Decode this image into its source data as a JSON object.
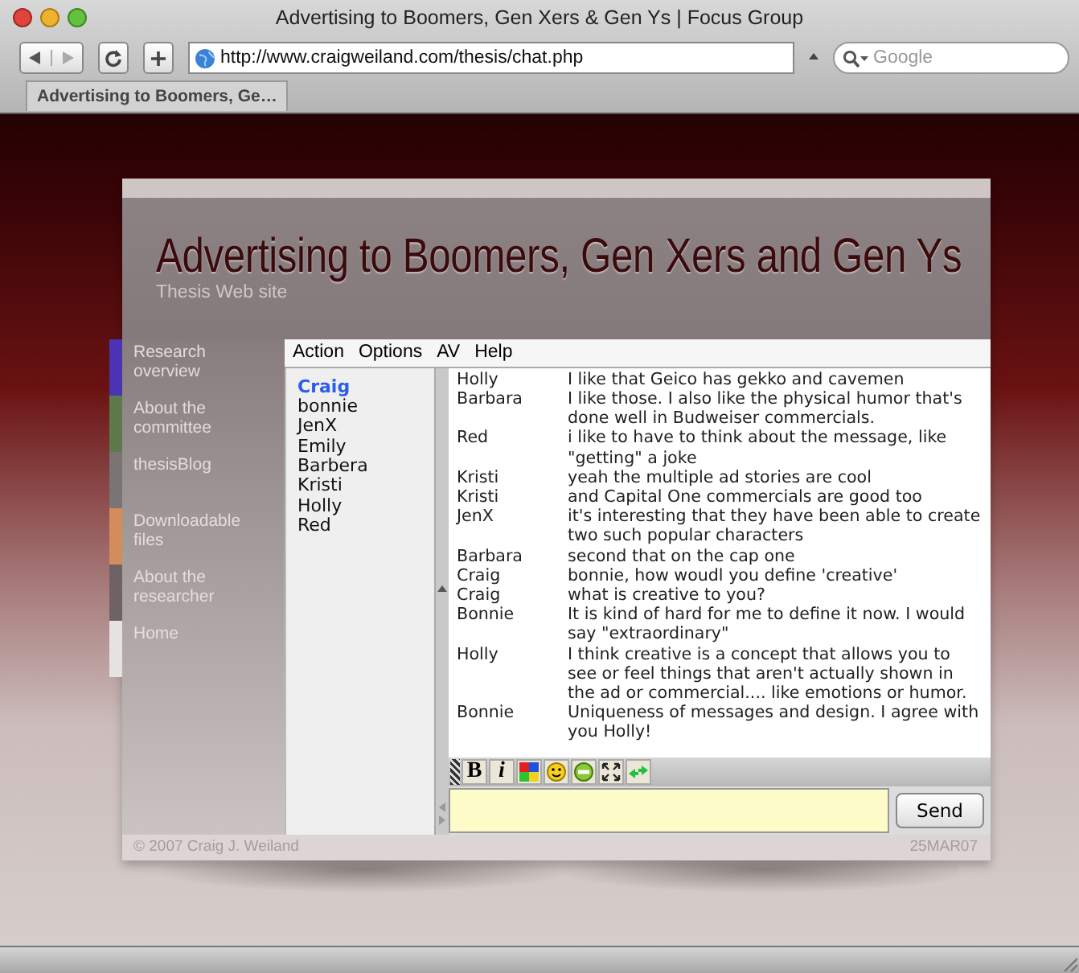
{
  "window": {
    "title": "Advertising to Boomers, Gen Xers & Gen Ys | Focus Group"
  },
  "toolbar": {
    "url": "http://www.craigweiland.com/thesis/chat.php",
    "search": {
      "placeholder": "Google"
    }
  },
  "tabs": [
    {
      "label": "Advertising to Boomers, Ge…",
      "selected": true
    }
  ],
  "site": {
    "title": "Advertising to Boomers, Gen Xers and Gen Ys",
    "subtitle": "Thesis Web site",
    "nav": [
      {
        "label": "Research overview",
        "color": "#4b33b5"
      },
      {
        "label": "About the committee",
        "color": "#5e7a4c"
      },
      {
        "label": "thesisBlog",
        "color": "#7a7474"
      },
      {
        "label": "Downloadable files",
        "color": "#d38d5c"
      },
      {
        "label": "About the researcher",
        "color": "#6f6264"
      },
      {
        "label": "Home",
        "color": "#e6e2e2"
      }
    ],
    "footer": {
      "copyright": "© 2007 Craig J. Weiland",
      "date": "25MAR07"
    }
  },
  "chat": {
    "menu": [
      "Action",
      "Options",
      "AV",
      "Help"
    ],
    "users": [
      {
        "name": "Craig",
        "selected": true
      },
      {
        "name": "bonnie",
        "selected": false
      },
      {
        "name": "JenX",
        "selected": false
      },
      {
        "name": "Emily",
        "selected": false
      },
      {
        "name": "Barbera",
        "selected": false
      },
      {
        "name": "Kristi",
        "selected": false
      },
      {
        "name": "Holly",
        "selected": false
      },
      {
        "name": "Red",
        "selected": false
      }
    ],
    "messages": [
      {
        "author": "Holly",
        "text": "I like that Geico has gekko and cavemen"
      },
      {
        "author": "Barbara",
        "text": "I like those. I also like the physical humor that's done well in Budweiser commercials."
      },
      {
        "author": "Red",
        "text": "i like to have to think about the message, like \"getting\" a joke"
      },
      {
        "author": "Kristi",
        "text": "yeah the multiple ad stories are cool"
      },
      {
        "author": "Kristi",
        "text": "and Capital One commercials are good too"
      },
      {
        "author": "JenX",
        "text": "it's interesting that they have been able to create two such popular characters"
      },
      {
        "author": "Barbara",
        "text": "second that on the cap one"
      },
      {
        "author": "Craig",
        "text": "bonnie, how woudl you define 'creative'"
      },
      {
        "author": "Craig",
        "text": "what is creative to you?"
      },
      {
        "author": "Bonnie",
        "text": "It is kind of hard for me to define it now. I would say \"extraordinary\""
      },
      {
        "author": "Holly",
        "text": "I think creative is a concept that allows you to see or feel things that aren't actually shown in the ad or commercial.... like emotions or humor."
      },
      {
        "author": "Bonnie",
        "text": "Uniqueness of messages and design. I agree with you Holly!"
      }
    ],
    "format_buttons": [
      {
        "kind": "bold",
        "label": "B"
      },
      {
        "kind": "italic",
        "label": "i"
      },
      {
        "kind": "color"
      },
      {
        "kind": "smiley"
      },
      {
        "kind": "minus"
      },
      {
        "kind": "expand"
      },
      {
        "kind": "arrows"
      }
    ],
    "send": "Send"
  }
}
